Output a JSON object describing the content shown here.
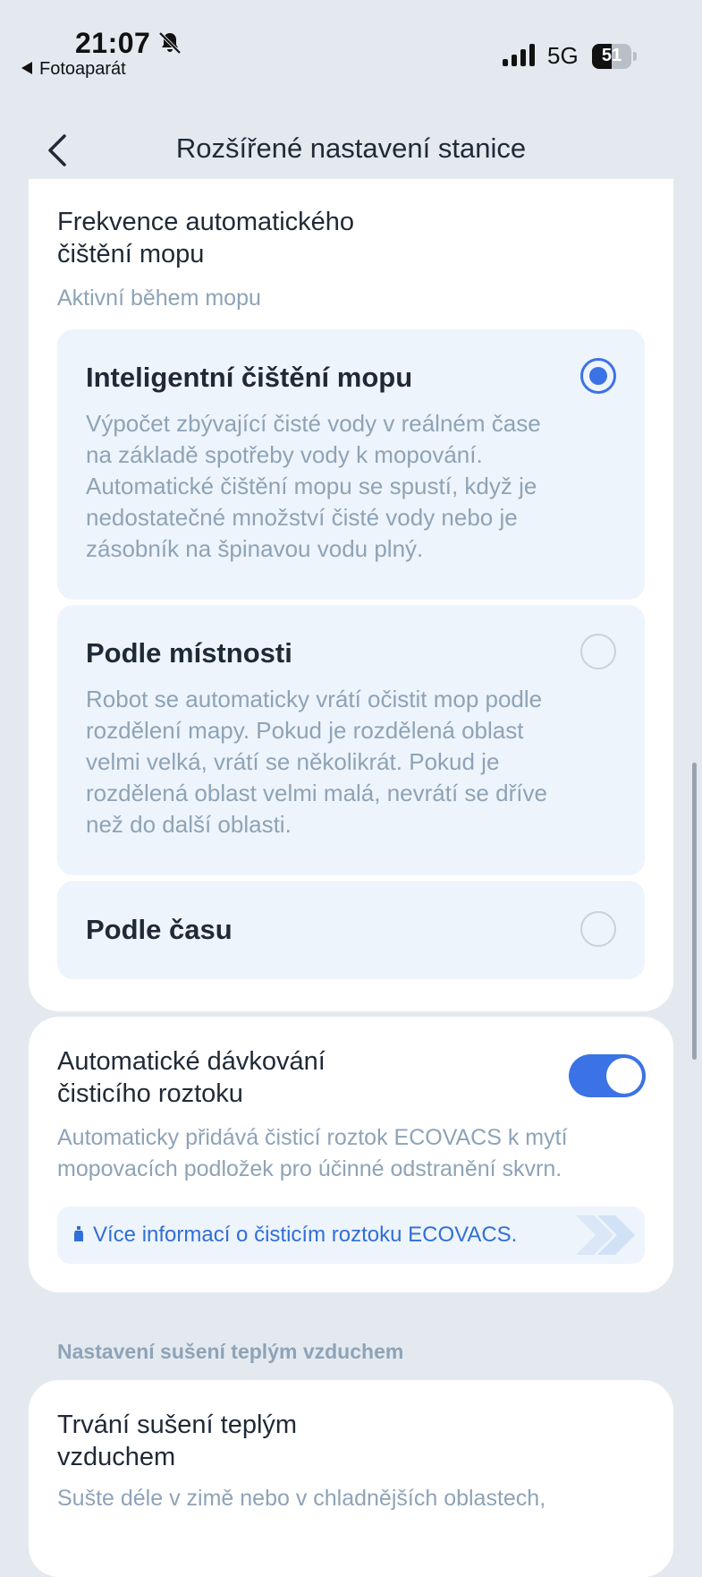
{
  "status_bar": {
    "time": "21:07",
    "back_app": "Fotoaparát",
    "network": "5G",
    "battery": "51",
    "battery_level": 0.51
  },
  "nav": {
    "title": "Rozšířené nastavení stanice"
  },
  "mop_frequency": {
    "title_line1": "Frekvence automatického",
    "title_line2": "čištění mopu",
    "subtitle": "Aktivní během mopu",
    "options": [
      {
        "label": "Inteligentní čištění mopu",
        "selected": true,
        "desc_lines": [
          "Výpočet zbývající čisté vody v reálném čase",
          "na základě spotřeby vody k mopování.",
          "Automatické čištění mopu se spustí, když je",
          "nedostatečné množství čisté vody nebo je",
          "zásobník na špinavou vodu plný."
        ]
      },
      {
        "label": "Podle místnosti",
        "selected": false,
        "desc_lines": [
          "Robot se automaticky vrátí očistit mop podle",
          "rozdělení mapy. Pokud je rozdělená oblast",
          "velmi velká, vrátí se několikrát. Pokud je",
          "rozdělená oblast velmi malá, nevrátí se dříve",
          "než do další oblasti."
        ]
      },
      {
        "label": "Podle času",
        "selected": false
      }
    ]
  },
  "auto_dosing": {
    "title_line1": "Automatické dávkování",
    "title_line2": "čisticího roztoku",
    "enabled": true,
    "desc_line1": "Automaticky přidává čisticí roztok ECOVACS k mytí",
    "desc_line2": "mopovacích podložek pro účinné odstranění skvrn.",
    "info_link": "Více informací o čisticím roztoku ECOVACS."
  },
  "drying": {
    "section_label": "Nastavení sušení teplým vzduchem",
    "title_line1": "Trvání sušení teplým",
    "title_line2": "vzduchem",
    "desc_line1": "Sušte déle v zimě nebo v chladnějších oblastech,"
  },
  "colors": {
    "accent": "#3b72e6",
    "background": "#e4e9f0",
    "muted_text": "#8ea3b7",
    "option_bg": "#eef4fb"
  }
}
